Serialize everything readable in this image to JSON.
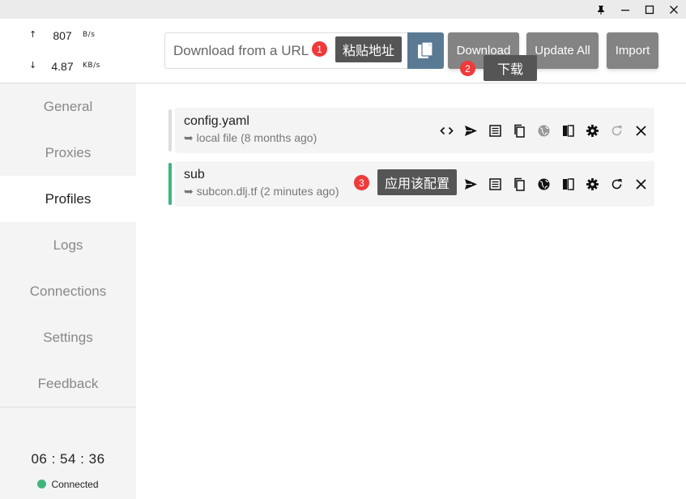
{
  "window": {
    "controls": [
      "pin-icon",
      "minimize-icon",
      "maximize-icon",
      "close-icon"
    ]
  },
  "traffic": {
    "upload": {
      "arrow": "↑",
      "value": "807",
      "unit": "B/s"
    },
    "download": {
      "arrow": "↓",
      "value": "4.87",
      "unit": "KB/s"
    }
  },
  "nav": {
    "items": [
      "General",
      "Proxies",
      "Profiles",
      "Logs",
      "Connections",
      "Settings",
      "Feedback"
    ],
    "active": "Profiles"
  },
  "footer": {
    "time": "06 : 54 : 36",
    "status": "Connected",
    "status_color": "#3db67d"
  },
  "toolbar": {
    "url_placeholder": "Download from a URL",
    "download_label": "Download",
    "update_all_label": "Update All",
    "import_label": "Import"
  },
  "profiles": [
    {
      "name": "config.yaml",
      "source": "➥ local file (8 months ago)",
      "selected": false
    },
    {
      "name": "sub",
      "source": "➥ subcon.dlj.tf (2 minutes ago)",
      "selected": true
    }
  ],
  "annotations": [
    {
      "number": "1",
      "text": "粘贴地址"
    },
    {
      "number": "2",
      "text": "下载"
    },
    {
      "number": "3",
      "text": "应用该配置"
    }
  ],
  "colors": {
    "accent": "#3db67d",
    "paste_button": "#5a7a94",
    "gray_button": "#848484",
    "badge": "#ee3a3a"
  }
}
